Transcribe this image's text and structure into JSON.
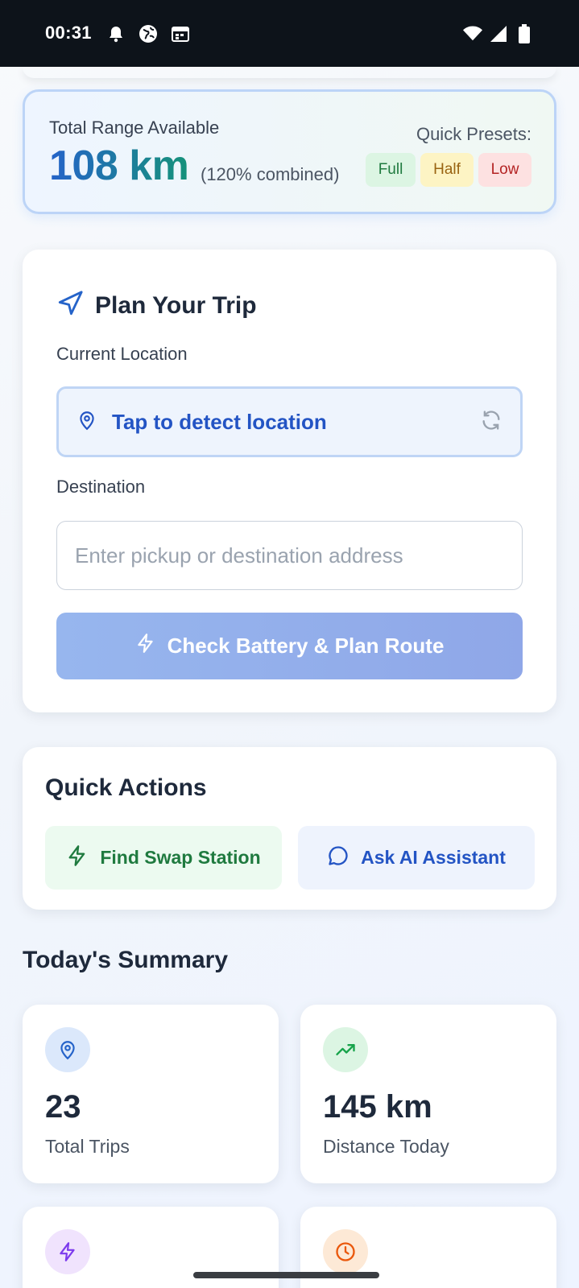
{
  "status_bar": {
    "time": "00:31",
    "left_icons": [
      "notification-bell-icon",
      "vpn-globe-icon",
      "calendar-icon"
    ],
    "right_icons": [
      "wifi-icon",
      "signal-icon",
      "battery-icon"
    ]
  },
  "range": {
    "label": "Total Range Available",
    "value": "108 km",
    "combined": "(120% combined)",
    "presets_label": "Quick Presets:",
    "presets": [
      "Full",
      "Half",
      "Low"
    ]
  },
  "trip": {
    "title": "Plan Your Trip",
    "current_location_label": "Current Location",
    "current_location_value": "Tap to detect location",
    "destination_label": "Destination",
    "destination_placeholder": "Enter pickup or destination address",
    "plan_button": "Check Battery & Plan Route"
  },
  "quick_actions": {
    "title": "Quick Actions",
    "find_swap": "Find Swap Station",
    "ask_ai": "Ask AI Assistant"
  },
  "summary": {
    "title": "Today's Summary",
    "stats": [
      {
        "value": "23",
        "label": "Total Trips",
        "icon": "location-pin-icon",
        "color": "#2563c9"
      },
      {
        "value": "145 km",
        "label": "Distance Today",
        "icon": "trending-up-icon",
        "color": "#16a34a"
      },
      {
        "value": "",
        "label": "",
        "icon": "lightning-icon",
        "color": "#7c3aed"
      },
      {
        "value": "",
        "label": "",
        "icon": "clock-icon",
        "color": "#ea580c"
      }
    ]
  },
  "colors": {
    "primary": "#2563c9",
    "green": "#16a34a",
    "purple": "#7c3aed",
    "orange": "#ea580c"
  }
}
